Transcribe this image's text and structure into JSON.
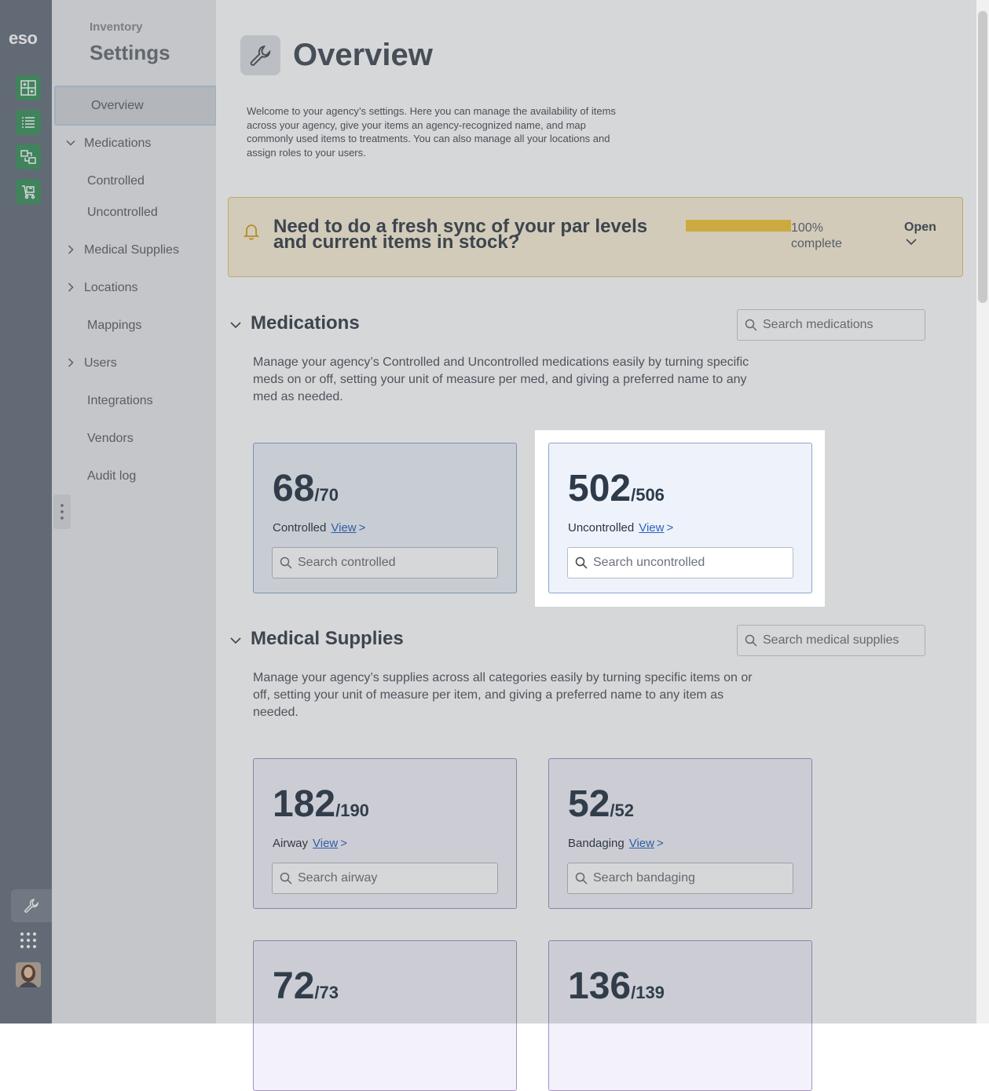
{
  "rail": {
    "logo": "eso",
    "apps": [
      "inventory-app-icon",
      "list-app-icon",
      "transfer-app-icon",
      "cart-app-icon"
    ],
    "bottom": [
      "wrench-icon",
      "grid-icon",
      "avatar"
    ]
  },
  "sidebar": {
    "supertitle": "Inventory",
    "title": "Settings",
    "items": {
      "overview": "Overview",
      "medications": "Medications",
      "controlled": "Controlled",
      "uncontrolled": "Uncontrolled",
      "medical_supplies": "Medical Supplies",
      "locations": "Locations",
      "mappings": "Mappings",
      "users": "Users",
      "integrations": "Integrations",
      "vendors": "Vendors",
      "audit_log": "Audit log"
    }
  },
  "page": {
    "title": "Overview",
    "description": "Welcome to your agency’s settings. Here you can manage the availability of items across your agency, give your items an agency-recognized name, and map commonly used items to treatments. You can also manage all your locations and assign roles to your users."
  },
  "banner": {
    "text": "Need to do a fresh sync of your par levels and current items in stock?",
    "progress_percent": 100,
    "progress_value": "100%",
    "progress_suffix": "complete",
    "action": "Open"
  },
  "medications": {
    "title": "Medications",
    "search_placeholder": "Search medications",
    "description": "Manage your agency’s Controlled and Uncontrolled medications easily by turning specific meds on or off, setting your unit of measure per med, and giving a preferred name to any med as needed.",
    "cards": {
      "controlled": {
        "count": "68",
        "total": "/70",
        "label": "Controlled",
        "view": "View",
        "arrow": ">",
        "search_placeholder": "Search controlled"
      },
      "uncontrolled": {
        "count": "502",
        "total": "/506",
        "label": "Uncontrolled",
        "view": "View",
        "arrow": ">",
        "search_placeholder": "Search uncontrolled"
      }
    }
  },
  "supplies": {
    "title": "Medical Supplies",
    "search_placeholder": "Search medical supplies",
    "description": "Manage your agency’s supplies across all categories easily by turning specific items on or off, setting your unit of measure per item, and giving a preferred name to any item as needed.",
    "cards": {
      "airway": {
        "count": "182",
        "total": "/190",
        "label": "Airway",
        "view": "View",
        "arrow": ">",
        "search_placeholder": "Search airway"
      },
      "bandaging": {
        "count": "52",
        "total": "/52",
        "label": "Bandaging",
        "view": "View",
        "arrow": ">",
        "search_placeholder": "Search bandaging"
      },
      "first_aid": {
        "count": "72",
        "total": "/73"
      },
      "iv_therapy": {
        "count": "136",
        "total": "/139"
      }
    }
  },
  "colors": {
    "accent_green": "#3f9460",
    "link_blue": "#2b63c2",
    "banner_yellow": "#f2c63c"
  }
}
